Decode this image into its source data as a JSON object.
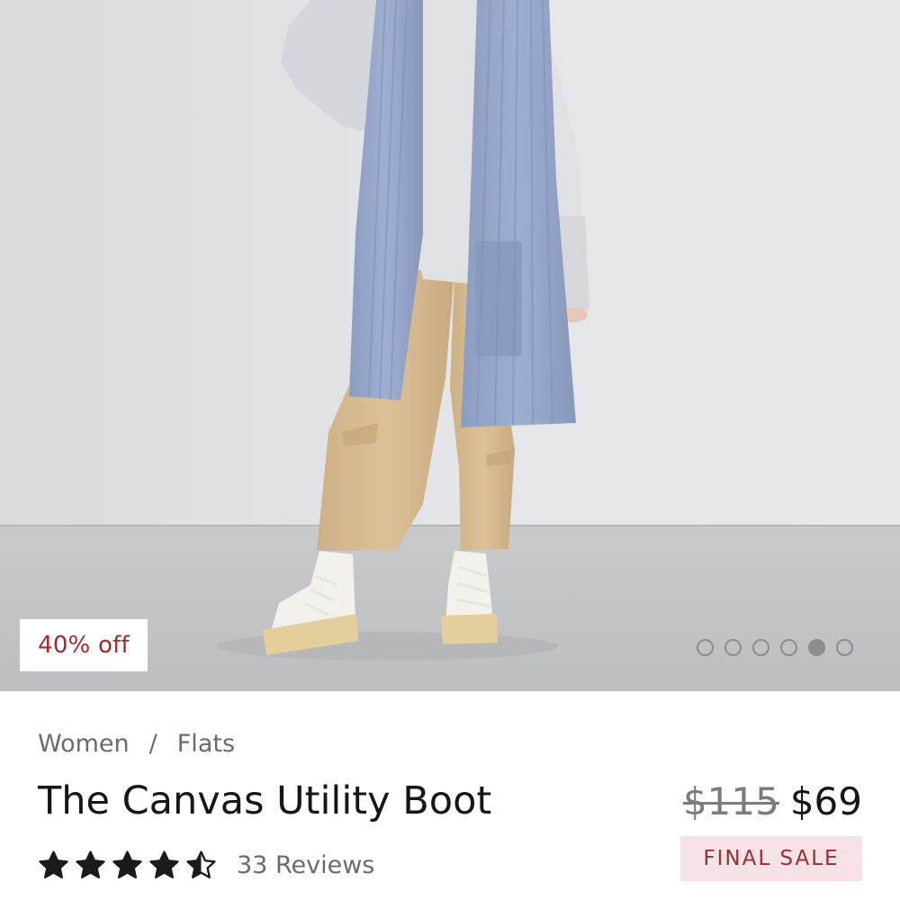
{
  "badge": {
    "discount": "40% off"
  },
  "carousel": {
    "slide_count": 6,
    "active_index": 4
  },
  "breadcrumb": {
    "items": [
      "Women",
      "Flats"
    ],
    "separator": "/"
  },
  "product": {
    "title": "The Canvas Utility Boot",
    "price_original": "$115",
    "price_sale": "$69",
    "final_sale_label": "FINAL SALE",
    "rating": 4.5,
    "rating_max": 5,
    "reviews_label": "33 Reviews"
  },
  "colors": {
    "discount_text": "#a32a2a",
    "final_sale_bg": "#f7e3e5",
    "final_sale_text": "#9c2b33",
    "muted_text": "#6b6b6b"
  }
}
